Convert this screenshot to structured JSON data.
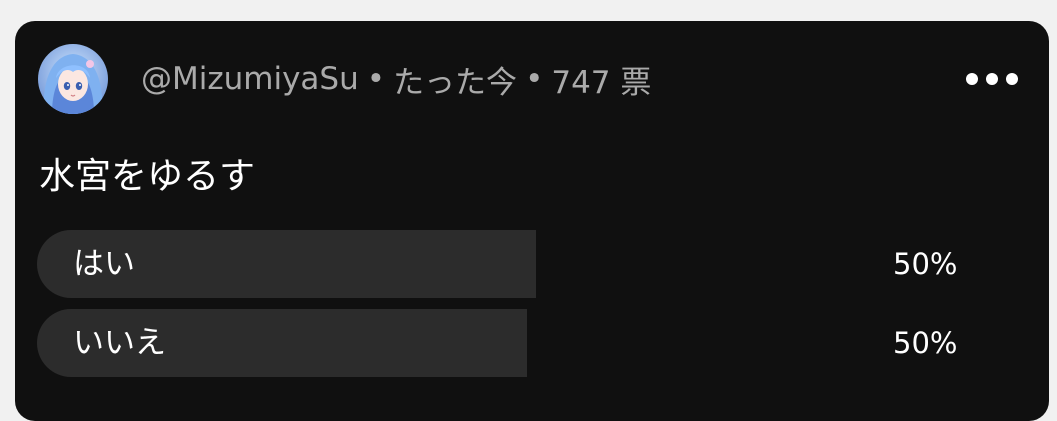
{
  "post": {
    "author": "@MizumiyaSu",
    "separator": "•",
    "time": "たった今",
    "votes": "747 票",
    "question": "水宮をゆるす"
  },
  "icons": {
    "avatar": "user-avatar",
    "menu": "more-horizontal-icon"
  },
  "poll": {
    "options": [
      {
        "label": "はい",
        "percent": "50%",
        "fill_fraction": 0.52
      },
      {
        "label": "いいえ",
        "percent": "50%",
        "fill_fraction": 0.51
      }
    ]
  },
  "colors": {
    "card_background": "#101010",
    "bar": "#2c2c2c",
    "meta_text": "#aaaaaa",
    "text": "#ffffff"
  }
}
